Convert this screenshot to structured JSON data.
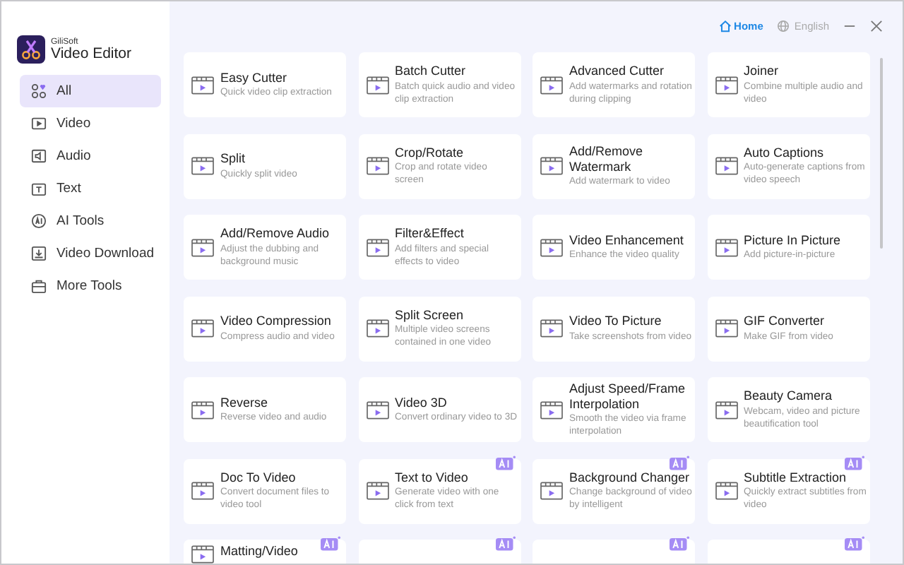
{
  "brand": {
    "company": "GiliSoft",
    "product": "Video Editor"
  },
  "topbar": {
    "home": "Home",
    "language": "English"
  },
  "sidebar": {
    "items": [
      {
        "label": "All",
        "selected": true
      },
      {
        "label": "Video",
        "selected": false
      },
      {
        "label": "Audio",
        "selected": false
      },
      {
        "label": "Text",
        "selected": false
      },
      {
        "label": "AI Tools",
        "selected": false
      },
      {
        "label": "Video Download",
        "selected": false
      },
      {
        "label": "More Tools",
        "selected": false
      }
    ]
  },
  "tools": [
    {
      "title": "Easy Cutter",
      "description": "Quick video clip extraction",
      "ai": false
    },
    {
      "title": "Batch Cutter",
      "description": "Batch quick audio and video clip extraction",
      "ai": false
    },
    {
      "title": "Advanced Cutter",
      "description": "Add watermarks and rotation during clipping",
      "ai": false
    },
    {
      "title": "Joiner",
      "description": "Combine multiple audio and video",
      "ai": false
    },
    {
      "title": "Split",
      "description": "Quickly split video",
      "ai": false
    },
    {
      "title": "Crop/Rotate",
      "description": "Crop and rotate video screen",
      "ai": false
    },
    {
      "title": "Add/Remove Watermark",
      "description": "Add watermark to video",
      "ai": false
    },
    {
      "title": "Auto Captions",
      "description": "Auto-generate captions from video speech",
      "ai": false
    },
    {
      "title": "Add/Remove Audio",
      "description": "Adjust the dubbing and background music",
      "ai": false
    },
    {
      "title": "Filter&Effect",
      "description": "Add filters and special effects to video",
      "ai": false
    },
    {
      "title": "Video Enhancement",
      "description": "Enhance the video quality",
      "ai": false
    },
    {
      "title": "Picture In Picture",
      "description": "Add picture-in-picture",
      "ai": false
    },
    {
      "title": "Video Compression",
      "description": "Compress audio and video",
      "ai": false
    },
    {
      "title": "Split Screen",
      "description": "Multiple video screens contained in one video",
      "ai": false
    },
    {
      "title": "Video To Picture",
      "description": "Take screenshots from video",
      "ai": false
    },
    {
      "title": "GIF Converter",
      "description": "Make GIF from video",
      "ai": false
    },
    {
      "title": "Reverse",
      "description": "Reverse video and audio",
      "ai": false
    },
    {
      "title": "Video 3D",
      "description": "Convert ordinary video to 3D",
      "ai": false
    },
    {
      "title": "Adjust Speed/Frame Interpolation",
      "description": "Smooth the video via frame interpolation",
      "ai": false
    },
    {
      "title": "Beauty Camera",
      "description": "Webcam, video and picture beautification tool",
      "ai": false
    },
    {
      "title": "Doc To Video",
      "description": "Convert document files to video tool",
      "ai": false
    },
    {
      "title": "Text to Video",
      "description": "Generate video with one click from text",
      "ai": true
    },
    {
      "title": "Background Changer",
      "description": "Change background of video by intelligent",
      "ai": true
    },
    {
      "title": "Subtitle Extraction",
      "description": "Quickly extract subtitles from video",
      "ai": true
    },
    {
      "title": "Matting/Video",
      "ai": true
    },
    {
      "ai": true
    },
    {
      "ai": true
    },
    {
      "ai": true
    }
  ]
}
